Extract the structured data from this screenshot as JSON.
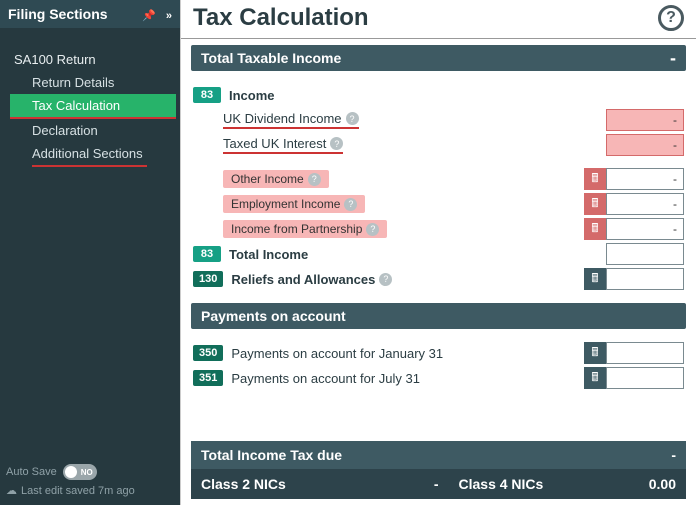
{
  "sidebar": {
    "title": "Filing Sections",
    "root": "SA100 Return",
    "items": [
      {
        "label": "Return Details"
      },
      {
        "label": "Tax Calculation"
      },
      {
        "label": "Declaration"
      },
      {
        "label": "Additional Sections"
      }
    ],
    "autosave_label": "Auto Save",
    "toggle_state": "NO",
    "last_edit": "Last edit saved 7m ago"
  },
  "header": {
    "title": "Tax Calculation"
  },
  "section_income": {
    "title": "Total Taxable Income",
    "rows": {
      "income_tag": "83",
      "income_label": "Income",
      "uk_div": "UK Dividend Income",
      "taxed_uk": "Taxed UK Interest",
      "other": "Other Income",
      "employment": "Employment Income",
      "partnership": "Income from Partnership",
      "total_tag": "83",
      "total_label": "Total Income",
      "reliefs_tag": "130",
      "reliefs_label": "Reliefs and Allowances"
    },
    "values": {
      "uk_div": "-",
      "taxed_uk": "-",
      "other": "-",
      "employment": "-",
      "partnership": "-",
      "total": "",
      "reliefs": ""
    }
  },
  "section_payments": {
    "title": "Payments on account",
    "rows": {
      "jan_tag": "350",
      "jan_label": "Payments on account for January 31",
      "jul_tag": "351",
      "jul_label": "Payments on account for July 31"
    },
    "values": {
      "jan": "",
      "jul": ""
    }
  },
  "totals": {
    "title": "Total Income Tax due",
    "total_value": "-",
    "class2_label": "Class 2 NICs",
    "class2_value": "-",
    "class4_label": "Class 4 NICs",
    "class4_value": "0.00"
  }
}
